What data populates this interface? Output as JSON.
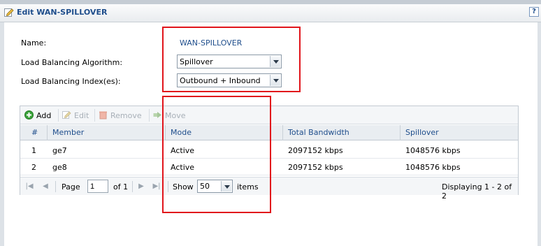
{
  "window": {
    "title": "Edit WAN-SPILLOVER",
    "help_label": "?"
  },
  "form": {
    "name_label": "Name:",
    "name_value": "WAN-SPILLOVER",
    "algorithm_label": "Load Balancing Algorithm:",
    "algorithm_value": "Spillover",
    "index_label": "Load Balancing Index(es):",
    "index_value": "Outbound + Inbound"
  },
  "toolbar": {
    "add": "Add",
    "edit": "Edit",
    "remove": "Remove",
    "move": "Move"
  },
  "table": {
    "columns": [
      "#",
      "Member",
      "Mode",
      "Total Bandwidth",
      "Spillover"
    ],
    "rows": [
      {
        "num": "1",
        "member": "ge7",
        "mode": "Active",
        "bandwidth": "2097152 kbps",
        "spillover": "1048576 kbps"
      },
      {
        "num": "2",
        "member": "ge8",
        "mode": "Active",
        "bandwidth": "2097152 kbps",
        "spillover": "1048576 kbps"
      }
    ]
  },
  "pager": {
    "page_label": "Page",
    "page_value": "1",
    "of_label": "of 1",
    "show_label": "Show",
    "show_value": "50",
    "items_label": "items",
    "displaying": "Displaying 1 - 2 of 2"
  },
  "colors": {
    "accent": "#1f4e8c",
    "highlight": "#e1141b"
  }
}
